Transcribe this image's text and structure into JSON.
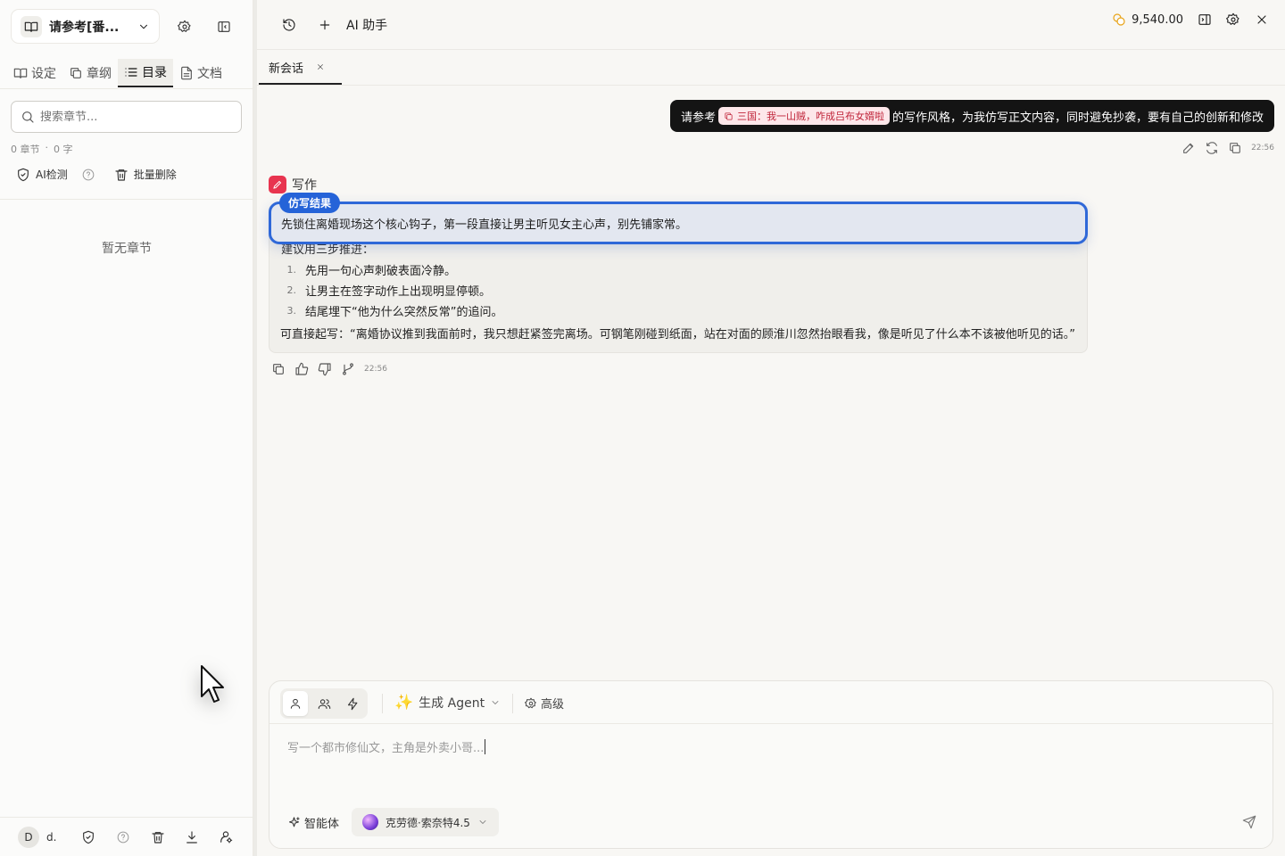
{
  "sidebar": {
    "project_name": "请参考[番...",
    "tabs": [
      "设定",
      "章纲",
      "目录",
      "文档"
    ],
    "active_tab": "目录",
    "search_placeholder": "搜索章节...",
    "stats": {
      "chapters": "0 章节",
      "dot": "·",
      "words": "0 字"
    },
    "ai_check": "AI检测",
    "batch_delete": "批量删除",
    "empty": "暂无章节",
    "user": {
      "initial": "D",
      "name": "d."
    }
  },
  "header": {
    "title": "AI 助手",
    "coins": "9,540.00"
  },
  "session_tab": "新会话",
  "user_message": {
    "prefix": "请参考",
    "reference": "三国：我一山贼，咋成吕布女婿啦",
    "suffix": "的写作风格，为我仿写正文内容，同时避免抄袭，要有自己的创新和修改",
    "time": "22:56"
  },
  "assistant": {
    "label": "写作",
    "badge": "仿写结果",
    "highlight": "先锁住离婚现场这个核心钩子，第一段直接让男主听见女主心声，别先铺家常。",
    "partial_line": "建议用三步推进：",
    "steps": [
      {
        "n": "1.",
        "text": "先用一句心声刺破表面冷静。"
      },
      {
        "n": "2.",
        "text": "让男主在签字动作上出现明显停顿。"
      },
      {
        "n": "3.",
        "text": "结尾埋下“他为什么突然反常”的追问。"
      }
    ],
    "direct": "可直接起写：“离婚协议推到我面前时，我只想赶紧签完离场。可钢笔刚碰到纸面，站在对面的顾淮川忽然抬眼看我，像是听见了什么本不该被他听见的话。”",
    "time": "22:56"
  },
  "composer": {
    "agent_label": "生成 Agent",
    "advanced": "高级",
    "placeholder": "写一个都市修仙文，主角是外卖小哥...",
    "agent_btn": "智能体",
    "model": "克劳德·索奈特4.5"
  }
}
